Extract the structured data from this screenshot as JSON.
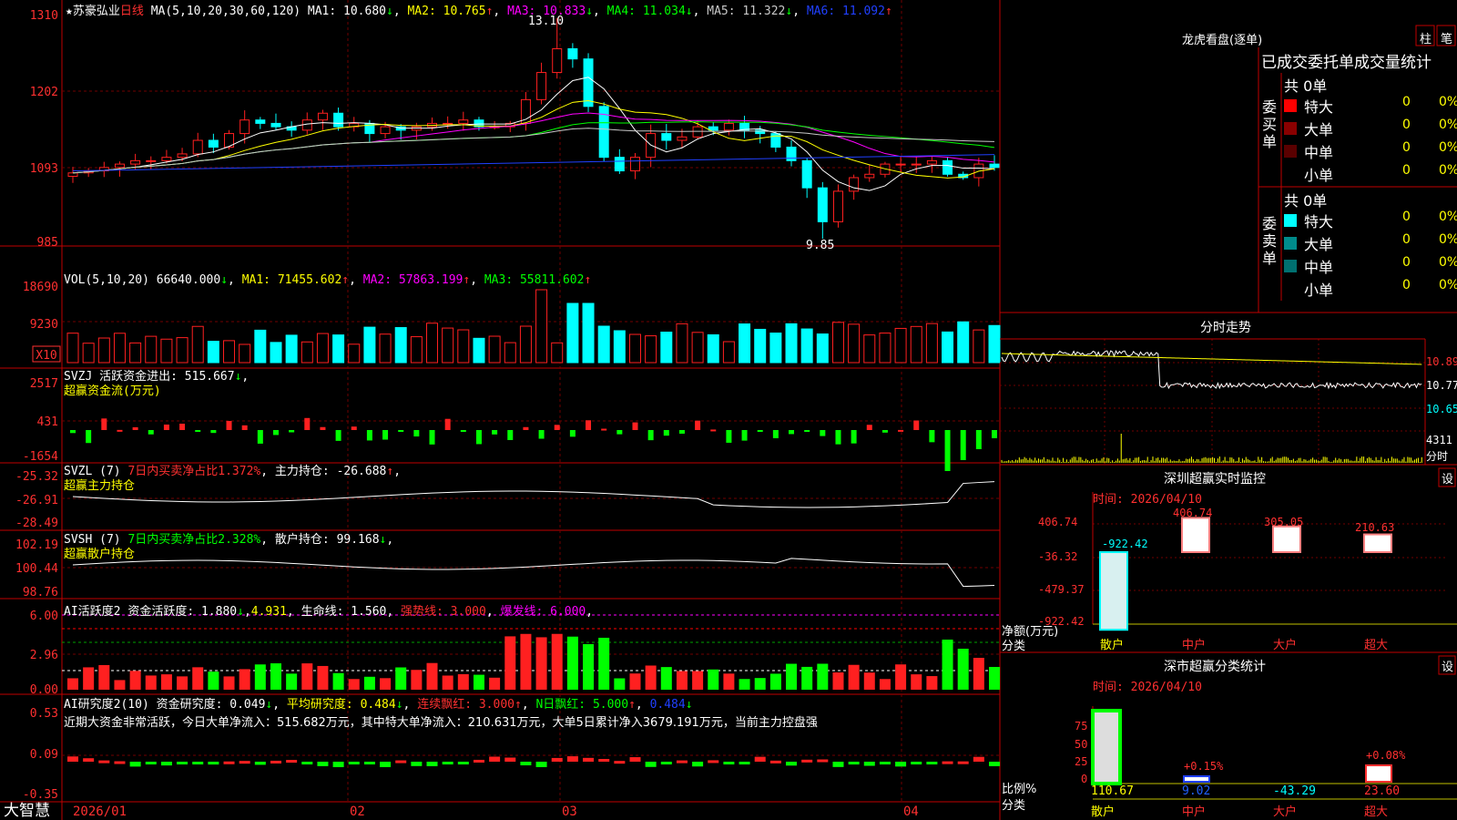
{
  "stock": {
    "star": "★",
    "name": "苏豪弘业",
    "period": "日线"
  },
  "ma_header": {
    "label": "MA(5,10,20,30,60,120)",
    "items": [
      {
        "label": "MA1:",
        "value": "10.680",
        "arrow": "↓",
        "color": "#ffffff"
      },
      {
        "label": "MA2:",
        "value": "10.765",
        "arrow": "↑",
        "color": "#ffff00"
      },
      {
        "label": "MA3:",
        "value": "10.833",
        "arrow": "↓",
        "color": "#ff00ff"
      },
      {
        "label": "MA4:",
        "value": "11.034",
        "arrow": "↓",
        "color": "#00ff00"
      },
      {
        "label": "MA5:",
        "value": "11.322",
        "arrow": "↓",
        "color": "#c8c8c8"
      },
      {
        "label": "MA6:",
        "value": "11.092",
        "arrow": "↑",
        "color": "#0000ff"
      }
    ]
  },
  "price_axis": {
    "ticks": [
      "1310",
      "1202",
      "1093",
      "985"
    ]
  },
  "annotations": {
    "high": "13.10",
    "low": "9.85"
  },
  "vol": {
    "header": "VOL(5,10,20)",
    "value": "66640.000",
    "arrow": "↓",
    "ma": [
      {
        "label": "MA1:",
        "value": "71455.602",
        "arrow": "↑",
        "color": "#ffff00"
      },
      {
        "label": "MA2:",
        "value": "57863.199",
        "arrow": "↑",
        "color": "#ff00ff"
      },
      {
        "label": "MA3:",
        "value": "55811.602",
        "arrow": "↑",
        "color": "#00ff00"
      }
    ],
    "ticks": [
      "18690",
      "9230"
    ],
    "unit": "X10"
  },
  "svzj": {
    "header": "SVZJ",
    "label": "活跃资金进出:",
    "value": "515.667",
    "arrow": "↓",
    "sub": "超赢资金流(万元)",
    "ticks": [
      "2517",
      "431",
      "-1654"
    ]
  },
  "svzl": {
    "header": "SVZL (7)",
    "ratio": "7日内买卖净占比1.372%",
    "label": "主力持仓:",
    "value": "-26.688",
    "arrow": "↑",
    "sub": "超赢主力持仓",
    "ticks": [
      "-25.32",
      "-26.91",
      "-28.49"
    ]
  },
  "svsh": {
    "header": "SVSH (7)",
    "ratio": "7日内买卖净占比2.328%",
    "label": "散户持仓:",
    "value": "99.168",
    "arrow": "↓",
    "sub": "超赢散户持仓",
    "ticks": [
      "102.19",
      "100.44",
      "98.76"
    ]
  },
  "ai1": {
    "header": "AI活跃度2",
    "l1": "资金活跃度:",
    "v1": "1.880",
    "a1": "↓",
    "v2": "4.931",
    "l3": "生命线:",
    "v3": "1.560",
    "l4": "强势线:",
    "v4": "3.000",
    "l5": "爆发线:",
    "v5": "6.000",
    "ticks": [
      "6.00",
      "2.96",
      "0.00"
    ]
  },
  "ai2": {
    "header": "AI研究度2(10)",
    "l1": "资金研究度:",
    "v1": "0.049",
    "a1": "↓",
    "l2": "平均研究度:",
    "v2": "0.484",
    "a2": "↓",
    "l3": "连续飘红:",
    "v3": "3.000",
    "a3": "↑",
    "l4": "N日飘红:",
    "v4": "5.000",
    "a4": "↑",
    "v5": "0.484",
    "a5": "↓",
    "text": "近期大资金非常活跃，今日大单净流入：515.682万元，其中特大单净流入：210.631万元，大单5日累计净入3679.191万元，当前主力控盘强",
    "ticks": [
      "0.53",
      "0.09",
      "-0.35"
    ]
  },
  "xaxis": {
    "labels": [
      "2026/01",
      "02",
      "03",
      "04"
    ]
  },
  "brand": "大智慧",
  "dragon": {
    "title": "龙虎看盘(逐单)",
    "btn1": "柱",
    "btn2": "笔",
    "subtitle": "已成交委托单成交量统计",
    "buy": {
      "side": "委买单",
      "total": "共 0单",
      "rows": [
        {
          "label": "特大",
          "count": "0",
          "pct": "0%",
          "color": "#ff0000"
        },
        {
          "label": "大单",
          "count": "0",
          "pct": "0%",
          "color": "#8a0000"
        },
        {
          "label": "中单",
          "count": "0",
          "pct": "0%",
          "color": "#5a0000"
        },
        {
          "label": "小单",
          "count": "0",
          "pct": "0%",
          "color": ""
        }
      ]
    },
    "sell": {
      "side": "委卖单",
      "total": "共 0单",
      "rows": [
        {
          "label": "特大",
          "count": "0",
          "pct": "0%",
          "color": "#00ffff"
        },
        {
          "label": "大单",
          "count": "0",
          "pct": "0%",
          "color": "#008b8b"
        },
        {
          "label": "中单",
          "count": "0",
          "pct": "0%",
          "color": "#007070"
        },
        {
          "label": "小单",
          "count": "0",
          "pct": "0%",
          "color": ""
        }
      ]
    }
  },
  "intraday": {
    "title": "分时走势",
    "ticks": [
      "10.89",
      "10.77",
      "10.65"
    ],
    "vol": "4311",
    "unit": "分时"
  },
  "monitor": {
    "title": "深圳超赢实时监控",
    "btn": "设",
    "time": "时间: 2026/04/10",
    "ticks": [
      "406.74",
      "-36.32",
      "-479.37",
      "-922.42"
    ],
    "categories": [
      "散户",
      "中户",
      "大户",
      "超大"
    ],
    "values": [
      -922.42,
      406.74,
      305.05,
      210.63
    ],
    "labels": [
      "-922.42",
      "406.74",
      "305.05",
      "210.63"
    ],
    "ylabel": "净额(万元)",
    "xlabel": "分类"
  },
  "classify": {
    "title": "深市超赢分类统计",
    "btn": "设",
    "time": "时间: 2026/04/10",
    "ticks": [
      "75",
      "50",
      "25",
      "0"
    ],
    "categories": [
      "散户",
      "中户",
      "大户",
      "超大"
    ],
    "pct_labels": [
      "+0.15%",
      "+0.08%"
    ],
    "values": [
      "110.67",
      "9.02",
      "-43.29",
      "23.60"
    ],
    "ylabel": "比例%",
    "xlabel": "分类"
  },
  "chart_data": [
    {
      "type": "candlestick",
      "title": "苏豪弘业 日线",
      "x": [
        "2026/01",
        "02",
        "03",
        "04"
      ],
      "values": [
        10.82,
        10.85,
        10.9,
        10.95,
        11.0,
        11.0,
        11.05,
        11.1,
        11.3,
        11.2,
        11.4,
        11.6,
        11.55,
        11.5,
        11.45,
        11.6,
        11.7,
        11.5,
        11.55,
        11.4,
        11.5,
        11.45,
        11.5,
        11.55,
        11.55,
        11.6,
        11.5,
        11.5,
        11.55,
        11.9,
        12.3,
        12.65,
        12.5,
        11.8,
        11.05,
        10.85,
        11.05,
        11.4,
        11.3,
        11.35,
        11.5,
        11.45,
        11.55,
        11.45,
        11.4,
        11.2,
        11.0,
        10.6,
        10.1,
        10.55,
        10.75,
        10.8,
        10.95,
        10.95,
        10.95,
        11.0,
        10.8,
        10.75,
        10.95,
        10.9
      ],
      "ylim": [
        9.85,
        13.1
      ]
    },
    {
      "type": "bar",
      "title": "VOL(5,10,20)",
      "ticks": [
        "18690",
        "9230"
      ]
    },
    {
      "type": "bar",
      "title": "SVZJ 活跃资金进出",
      "ticks": [
        "2517",
        "431",
        "-1654"
      ]
    }
  ]
}
